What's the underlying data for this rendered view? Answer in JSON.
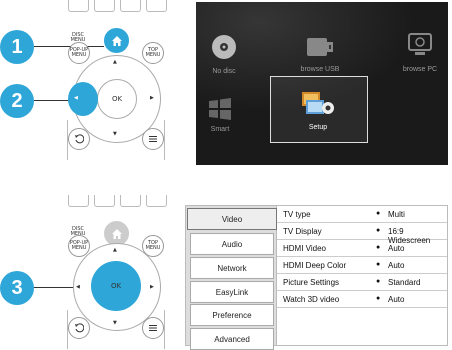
{
  "steps": [
    {
      "label": "1"
    },
    {
      "label": "2"
    },
    {
      "label": "3"
    }
  ],
  "remote": {
    "disc_menu_label": "DISC MENU",
    "popup_menu_label": "POP-UP MENU",
    "top_menu_label": "TOP MENU",
    "ok_label": "OK",
    "home_icon": "home-icon",
    "back_icon": "back-icon",
    "options_icon": "options-icon",
    "highlight_color": "#2ea6d8"
  },
  "home_menu": {
    "items": [
      {
        "label": "No disc",
        "icon": "disc-icon"
      },
      {
        "label": "browse USB",
        "icon": "usb-icon"
      },
      {
        "label": "browse PC",
        "icon": "pc-icon"
      },
      {
        "label": "Smart",
        "icon": "windows-icon"
      },
      {
        "label": "Setup",
        "icon": "setup-icon",
        "selected": true
      }
    ]
  },
  "settings": {
    "categories": [
      "Video",
      "Audio",
      "Network",
      "EasyLink",
      "Preference",
      "Advanced"
    ],
    "active_category": "Video",
    "options": [
      {
        "name": "TV type",
        "value": "Multi"
      },
      {
        "name": "TV Display",
        "value": "16:9 Widescreen"
      },
      {
        "name": "HDMI Video",
        "value": "Auto"
      },
      {
        "name": "HDMI Deep Color",
        "value": "Auto"
      },
      {
        "name": "Picture Settings",
        "value": "Standard"
      },
      {
        "name": "Watch 3D video",
        "value": "Auto"
      }
    ],
    "bullet": "●"
  }
}
